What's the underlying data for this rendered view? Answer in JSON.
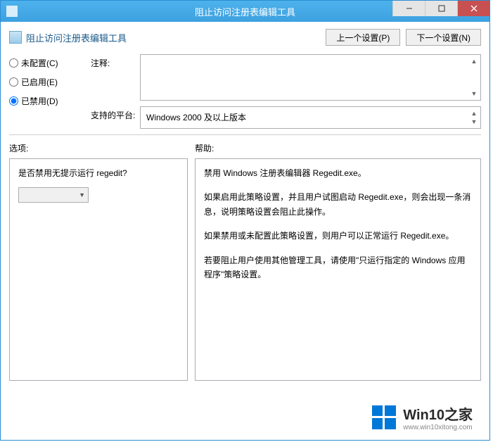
{
  "window": {
    "title": "阻止访问注册表编辑工具"
  },
  "header": {
    "subtitle": "阻止访问注册表编辑工具",
    "prev_btn": "上一个设置(P)",
    "next_btn": "下一个设置(N)"
  },
  "radios": {
    "not_configured": "未配置(C)",
    "enabled": "已启用(E)",
    "disabled": "已禁用(D)"
  },
  "fields": {
    "comment_label": "注释:",
    "platform_label": "支持的平台:",
    "platform_value": "Windows 2000 及以上版本"
  },
  "sections": {
    "options_label": "选项:",
    "help_label": "帮助:"
  },
  "options_panel": {
    "question": "是否禁用无提示运行 regedit?"
  },
  "help_panel": {
    "p1": "禁用 Windows 注册表编辑器 Regedit.exe。",
    "p2": "如果启用此策略设置，并且用户试图启动 Regedit.exe，则会出现一条消息，说明策略设置会阻止此操作。",
    "p3": "如果禁用或未配置此策略设置，则用户可以正常运行 Regedit.exe。",
    "p4": "若要阻止用户使用其他管理工具，请使用\"只运行指定的 Windows 应用程序\"策略设置。"
  },
  "watermark": {
    "main": "Win10之家",
    "sub": "www.win10xitong.com"
  }
}
